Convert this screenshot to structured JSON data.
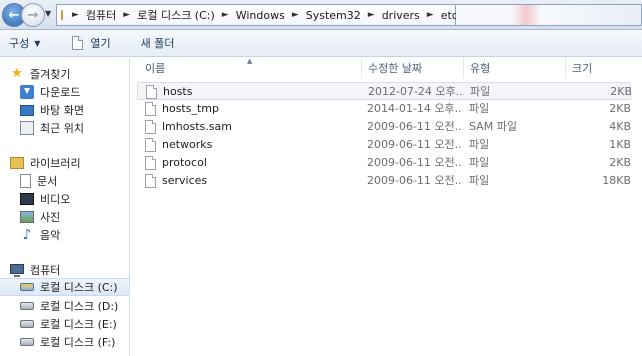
{
  "address": {
    "crumbs": [
      "컴퓨터",
      "로컬 디스크 (C:)",
      "Windows",
      "System32",
      "drivers",
      "etc"
    ]
  },
  "toolbar": {
    "organize_label": "구성",
    "open_label": "열기",
    "new_folder_label": "새 폴더"
  },
  "sidebar": {
    "favorites": {
      "label": "즐겨찾기",
      "items": [
        "다운로드",
        "바탕 화면",
        "최근 위치"
      ]
    },
    "libraries": {
      "label": "라이브러리",
      "items": [
        "문서",
        "비디오",
        "사진",
        "음악"
      ]
    },
    "computer": {
      "label": "컴퓨터",
      "drives": [
        "로컬 디스크 (C:)",
        "로컬 디스크 (D:)",
        "로컬 디스크 (E:)",
        "로컬 디스크 (F:)"
      ]
    }
  },
  "columns": {
    "name": "이름",
    "date": "수정한 날짜",
    "type": "유형",
    "size": "크기"
  },
  "files": [
    {
      "name": "hosts",
      "date": "2012-07-24 오후...",
      "type": "파일",
      "size": "2KB"
    },
    {
      "name": "hosts_tmp",
      "date": "2014-01-14 오후...",
      "type": "파일",
      "size": "2KB"
    },
    {
      "name": "lmhosts.sam",
      "date": "2009-06-11 오전...",
      "type": "SAM 파일",
      "size": "4KB"
    },
    {
      "name": "networks",
      "date": "2009-06-11 오전...",
      "type": "파일",
      "size": "1KB"
    },
    {
      "name": "protocol",
      "date": "2009-06-11 오전...",
      "type": "파일",
      "size": "2KB"
    },
    {
      "name": "services",
      "date": "2009-06-11 오전...",
      "type": "파일",
      "size": "18KB"
    }
  ]
}
